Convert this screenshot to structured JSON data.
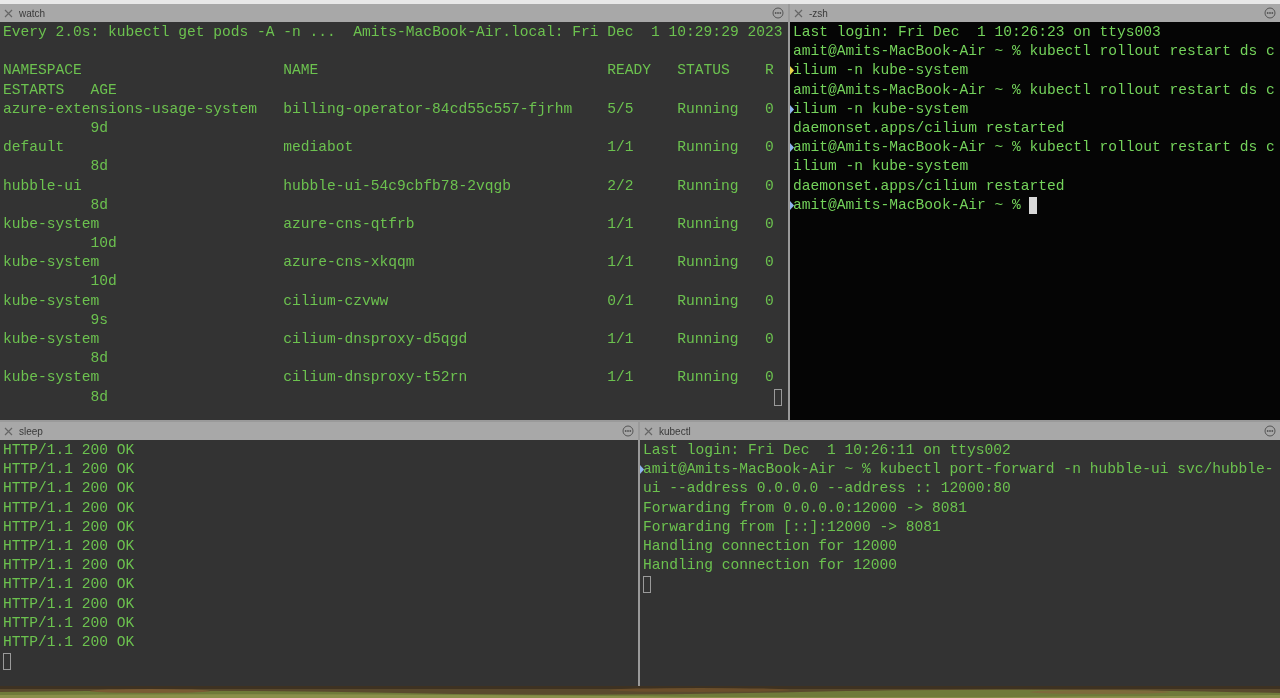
{
  "panes": [
    {
      "title": "watch",
      "active": false,
      "kind": "table",
      "header": "Every 2.0s: kubectl get pods -A -n ...  Amits-MacBook-Air.local: Fri Dec  1 10:29:29 2023",
      "columns": [
        "NAMESPACE",
        "NAME",
        "READY",
        "STATUS",
        "R"
      ],
      "columns_continued": "ESTARTS   AGE",
      "rows": [
        {
          "namespace": "azure-extensions-usage-system",
          "name": "billing-operator-84cd55c557-fjrhm",
          "ready": "5/5",
          "status": "Running",
          "restarts": "0",
          "age": "9d"
        },
        {
          "namespace": "default",
          "name": "mediabot",
          "ready": "1/1",
          "status": "Running",
          "restarts": "0",
          "age": "8d"
        },
        {
          "namespace": "hubble-ui",
          "name": "hubble-ui-54c9cbfb78-2vqgb",
          "ready": "2/2",
          "status": "Running",
          "restarts": "0",
          "age": "8d"
        },
        {
          "namespace": "kube-system",
          "name": "azure-cns-qtfrb",
          "ready": "1/1",
          "status": "Running",
          "restarts": "0",
          "age": "10d"
        },
        {
          "namespace": "kube-system",
          "name": "azure-cns-xkqqm",
          "ready": "1/1",
          "status": "Running",
          "restarts": "0",
          "age": "10d"
        },
        {
          "namespace": "kube-system",
          "name": "cilium-czvww",
          "ready": "0/1",
          "status": "Running",
          "restarts": "0",
          "age": "9s"
        },
        {
          "namespace": "kube-system",
          "name": "cilium-dnsproxy-d5qgd",
          "ready": "1/1",
          "status": "Running",
          "restarts": "0",
          "age": "8d"
        },
        {
          "namespace": "kube-system",
          "name": "cilium-dnsproxy-t52rn",
          "ready": "1/1",
          "status": "Running",
          "restarts": "0",
          "age": "8d"
        }
      ],
      "cursor": {
        "focused": false,
        "kind": "end"
      }
    },
    {
      "title": "-zsh",
      "active": true,
      "kind": "lines",
      "lines": [
        {
          "text": "Last login: Fri Dec  1 10:26:23 on ttys003"
        },
        {
          "text": "amit@Amits-MacBook-Air ~ % kubectl rollout restart ds c"
        },
        {
          "text": "ilium -n kube-system",
          "color": "#e8d44a"
        },
        {
          "text": "amit@Amits-MacBook-Air ~ % kubectl rollout restart ds c"
        },
        {
          "text": "ilium -n kube-system",
          "color": "#8fb4f0"
        },
        {
          "text": "daemonset.apps/cilium restarted"
        },
        {
          "text": "amit@Amits-MacBook-Air ~ % kubectl rollout restart ds c",
          "color": "#8fb4f0"
        },
        {
          "text": "ilium -n kube-system"
        },
        {
          "text": "daemonset.apps/cilium restarted"
        },
        {
          "text": "amit@Amits-MacBook-Air ~ %",
          "color": "#8fb4f0"
        }
      ],
      "cursor": {
        "focused": true,
        "kind": "inline"
      }
    },
    {
      "title": "sleep",
      "active": false,
      "kind": "lines",
      "lines": [
        {
          "text": "HTTP/1.1 200 OK"
        },
        {
          "text": "HTTP/1.1 200 OK"
        },
        {
          "text": "HTTP/1.1 200 OK"
        },
        {
          "text": "HTTP/1.1 200 OK"
        },
        {
          "text": "HTTP/1.1 200 OK"
        },
        {
          "text": "HTTP/1.1 200 OK"
        },
        {
          "text": "HTTP/1.1 200 OK"
        },
        {
          "text": "HTTP/1.1 200 OK"
        },
        {
          "text": "HTTP/1.1 200 OK"
        },
        {
          "text": "HTTP/1.1 200 OK"
        },
        {
          "text": "HTTP/1.1 200 OK"
        }
      ],
      "cursor": {
        "focused": false,
        "kind": "newline"
      }
    },
    {
      "title": "kubectl",
      "active": false,
      "kind": "lines",
      "lines": [
        {
          "text": "Last login: Fri Dec  1 10:26:11 on ttys002"
        },
        {
          "text": "amit@Amits-MacBook-Air ~ % kubectl port-forward -n hubble-ui svc/hubble-",
          "color": "#8fb4f0"
        },
        {
          "text": "ui --address 0.0.0.0 --address :: 12000:80"
        },
        {
          "text": "Forwarding from 0.0.0.0:12000 -> 8081"
        },
        {
          "text": "Forwarding from [::]:12000 -> 8081"
        },
        {
          "text": "Handling connection for 12000"
        },
        {
          "text": "Handling connection for 12000"
        }
      ],
      "cursor": {
        "focused": false,
        "kind": "newline"
      }
    }
  ]
}
